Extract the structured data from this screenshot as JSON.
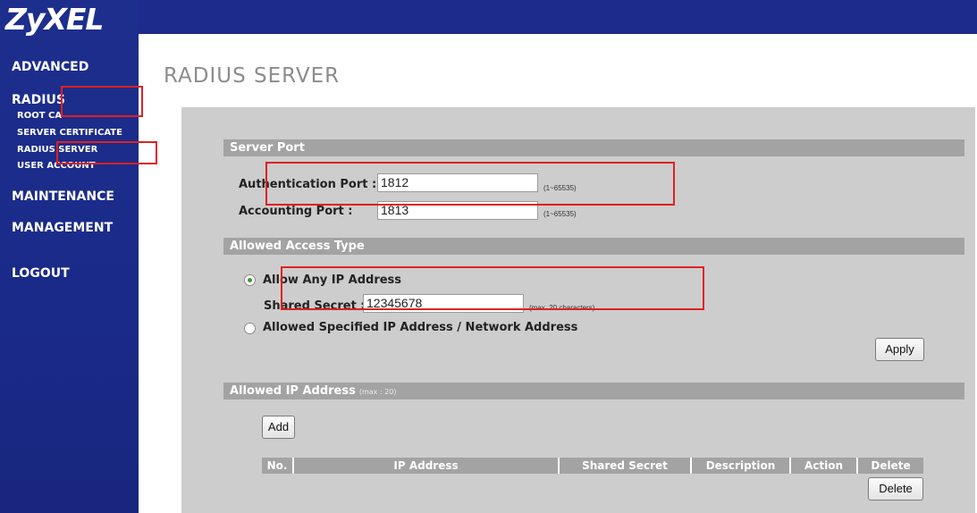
{
  "brand": {
    "logo": "ZyXEL"
  },
  "sidebar": {
    "advanced": "ADVANCED",
    "radius": "RADIUS",
    "sub_items": [
      "ROOT CA",
      "SERVER CERTIFICATE",
      "RADIUS SERVER",
      "USER ACCOUNT"
    ],
    "maintenance": "MAINTENANCE",
    "management": "MANAGEMENT",
    "logout": "LOGOUT"
  },
  "page": {
    "title": "RADIUS SERVER"
  },
  "server_port": {
    "section": "Server Port",
    "auth_label": "Authentication Port :",
    "auth_value": "1812",
    "auth_hint": "(1~65535)",
    "acct_label": "Accounting Port :",
    "acct_value": "1813",
    "acct_hint": "(1~65535)"
  },
  "access": {
    "section": "Allowed Access Type",
    "any_ip": "Allow Any IP Address",
    "any_ip_selected": true,
    "secret_label": "Shared Secret :",
    "secret_value": "12345678",
    "secret_hint": "(max. 20 characters)",
    "specified": "Allowed Specified IP Address / Network Address",
    "apply": "Apply"
  },
  "allowed_ip": {
    "section": "Allowed IP Address",
    "section_note": "(max : 20)",
    "add": "Add",
    "columns": [
      "No.",
      "IP Address",
      "Shared Secret",
      "Description",
      "Action",
      "Delete"
    ],
    "delete": "Delete"
  },
  "colors": {
    "nav_blue": "#1c2b8c",
    "section_gray": "#a3a3a3",
    "panel_gray": "#cdcdcd",
    "highlight_red": "#e02020"
  }
}
